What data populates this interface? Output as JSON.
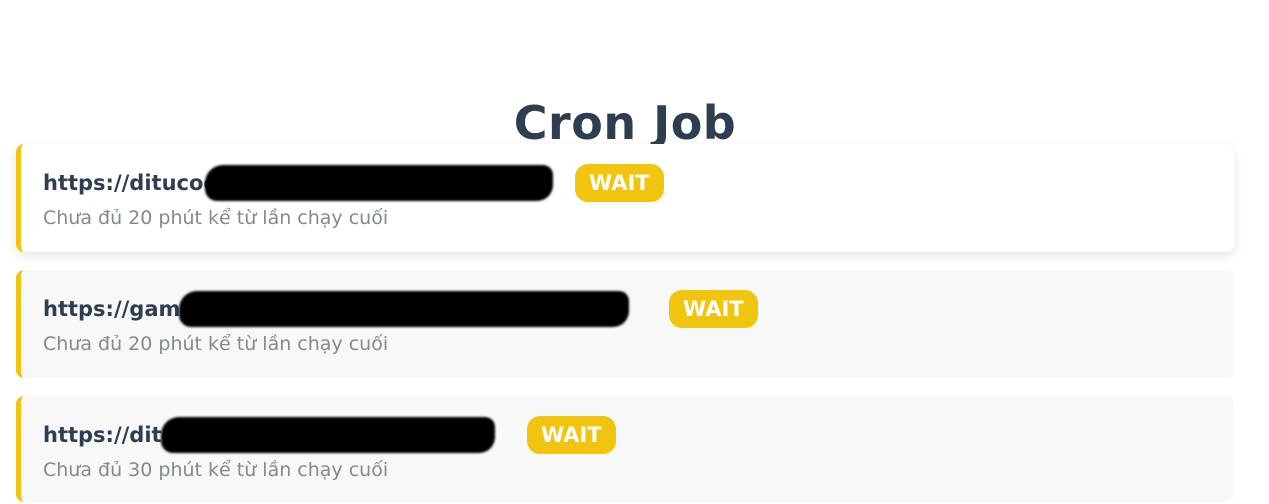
{
  "header": {
    "title": "Cron Job"
  },
  "jobs": [
    {
      "url": "https://ditucochhp",
      "status": "WAIT",
      "message": "Chưa đủ 20 phút kể từ lần chạy cuối"
    },
    {
      "url": "https://gamehp",
      "status": "WAIT",
      "message": "Chưa đủ 20 phút kể từ lần chạy cuối"
    },
    {
      "url": "https://dituhp",
      "status": "WAIT",
      "message": "Chưa đủ 30 phút kể từ lần chạy cuối"
    }
  ],
  "colors": {
    "accent": "#f1c40f",
    "title": "#2c3e50",
    "muted": "#7f8c8d"
  }
}
